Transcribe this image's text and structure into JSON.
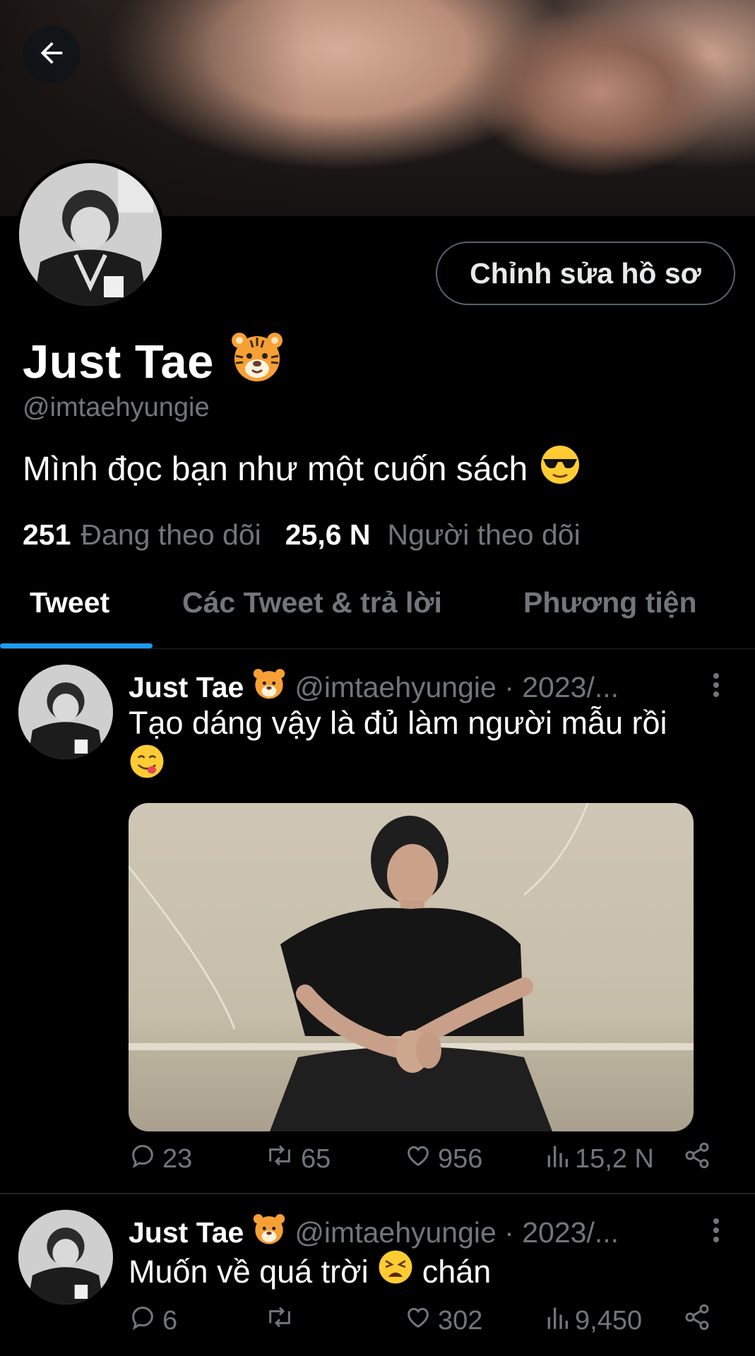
{
  "banner": {
    "alt": "profile banner"
  },
  "header": {
    "back_icon": "arrow-left-icon"
  },
  "profile": {
    "edit_button": "Chỉnh sửa hồ sơ",
    "name": "Just Tae",
    "name_emoji": "🐯",
    "handle": "@imtaehyungie",
    "bio": "Mình đọc bạn như một cuốn sách",
    "bio_emoji": "😎",
    "following_count": "251",
    "following_label": "Đang theo dõi",
    "followers_count": "25,6 N",
    "followers_label": "Người theo dõi"
  },
  "tabs": [
    {
      "label": "Tweet",
      "active": true
    },
    {
      "label": "Các Tweet & trả lời",
      "active": false
    },
    {
      "label": "Phương tiện",
      "active": false
    }
  ],
  "tweets": [
    {
      "name": "Just Tae",
      "emoji": "🐯",
      "meta": "@imtaehyungie · 2023/...",
      "text": "Tạo dáng vậy là đủ làm người mẫu rồi",
      "text_emoji": "😋",
      "replies": "23",
      "retweets": "65",
      "likes": "956",
      "views": "15,2 N"
    },
    {
      "name": "Just Tae",
      "emoji": "🐯",
      "meta": "@imtaehyungie · 2023/...",
      "text": "Muốn về quá trời",
      "text_emoji": "😫",
      "text_after": "chán",
      "replies": "6",
      "retweets": "",
      "likes": "302",
      "views": "9,450"
    }
  ],
  "colors": {
    "accent": "#1d9bf0",
    "muted": "#71767b",
    "background": "#000000"
  }
}
